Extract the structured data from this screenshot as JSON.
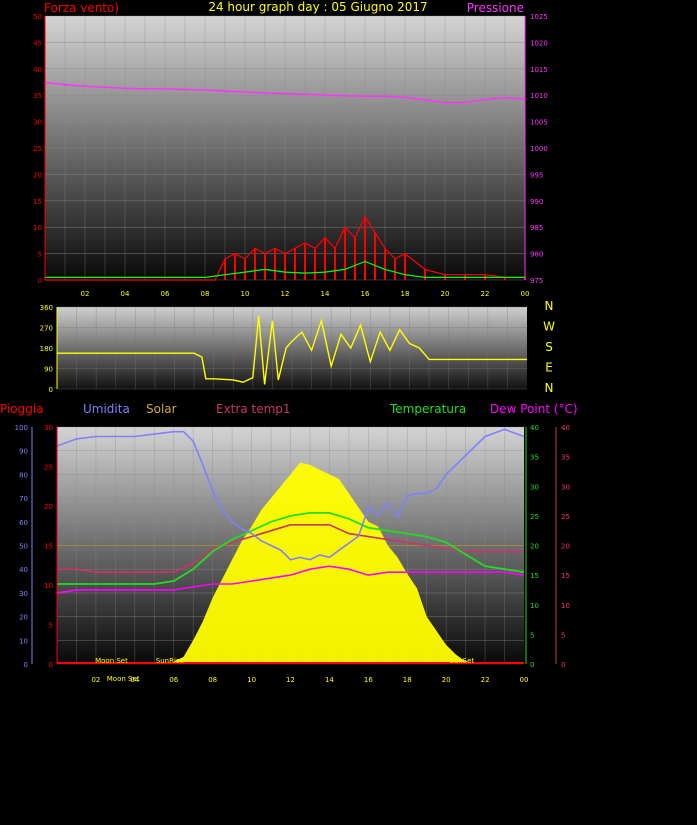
{
  "title": "24 hour graph day : 05 Giugno 2017",
  "colors": {
    "wind": "#ff0000",
    "gust": "#00ff00",
    "pressure": "#ff33ff",
    "direction": "#ffff00",
    "rain": "#ff0000",
    "humidity": "#8080ff",
    "solar": "#ffff00",
    "extra_temp": "#cc3366",
    "temperature": "#22dd22",
    "dew_point": "#ff00ff"
  },
  "chart_data": [
    {
      "type": "line",
      "left_label": "Forza vento)",
      "right_label": "Pressione",
      "left_ticks": [
        "0",
        "5",
        "10",
        "15",
        "20",
        "25",
        "30",
        "35",
        "40",
        "45",
        "50"
      ],
      "right_ticks": [
        "975",
        "980",
        "985",
        "990",
        "995",
        "1000",
        "1005",
        "1010",
        "1015",
        "1020",
        "1025"
      ],
      "x_ticks": [
        "02",
        "04",
        "06",
        "08",
        "10",
        "12",
        "14",
        "16",
        "18",
        "20",
        "22",
        "00"
      ],
      "ylim_left": [
        0,
        50
      ],
      "ylim_right": [
        975,
        1025
      ],
      "xlim": [
        0,
        24
      ],
      "grid": true,
      "series": [
        {
          "name": "Pressione",
          "axis": "right",
          "x": [
            0,
            1,
            2,
            3,
            4,
            5,
            6,
            7,
            8,
            9,
            10,
            11,
            12,
            13,
            14,
            15,
            16,
            17,
            18,
            19,
            20,
            21,
            22,
            23,
            24
          ],
          "values": [
            1012.4,
            1012.0,
            1011.7,
            1011.5,
            1011.3,
            1011.2,
            1011.2,
            1011.1,
            1011.0,
            1010.8,
            1010.6,
            1010.4,
            1010.3,
            1010.2,
            1010.0,
            1009.9,
            1009.8,
            1009.8,
            1009.6,
            1009.1,
            1008.6,
            1008.6,
            1009.2,
            1009.5,
            1009.3
          ]
        },
        {
          "name": "wind",
          "axis": "left",
          "x": [
            0,
            0.5,
            1,
            2,
            3,
            4,
            5,
            6,
            7,
            8,
            8.5,
            9,
            9.5,
            10,
            10.5,
            11,
            11.5,
            12,
            12.5,
            13,
            13.5,
            14,
            14.5,
            15,
            15.5,
            16,
            16.5,
            17,
            17.5,
            18,
            19,
            20,
            21,
            22,
            23,
            24
          ],
          "values": [
            0,
            0,
            0,
            0,
            0,
            0,
            0,
            0,
            0,
            0,
            0,
            4,
            5,
            4,
            6,
            5,
            6,
            5,
            6,
            7,
            6,
            8,
            6,
            10,
            8,
            12,
            9,
            6,
            4,
            5,
            2,
            1,
            1,
            1,
            0.5,
            0.5
          ]
        },
        {
          "name": "gust",
          "axis": "left",
          "x": [
            0,
            1,
            2,
            3,
            4,
            5,
            6,
            7,
            8,
            9,
            10,
            11,
            12,
            13,
            14,
            15,
            16,
            17,
            18,
            19,
            20,
            21,
            22,
            23,
            24
          ],
          "values": [
            0,
            0,
            0,
            0,
            0,
            0,
            0,
            0,
            0,
            0.5,
            1,
            1.5,
            1,
            0.8,
            1,
            1.5,
            3,
            1.5,
            0.5,
            0,
            0,
            0,
            0,
            0,
            0
          ]
        }
      ]
    },
    {
      "type": "line",
      "left_ticks": [
        "0",
        "90",
        "180",
        "270",
        "360"
      ],
      "right_labels": [
        "N",
        "W",
        "S",
        "E",
        "N"
      ],
      "ylim": [
        0,
        360
      ],
      "xlim": [
        0,
        24
      ],
      "grid": true,
      "series": [
        {
          "name": "direction",
          "x": [
            0,
            1,
            2,
            3,
            4,
            5,
            6,
            7,
            7.4,
            7.6,
            8,
            9,
            9.5,
            10,
            10.3,
            10.6,
            11,
            11.3,
            11.7,
            12,
            12.5,
            13,
            13.5,
            14,
            14.5,
            15,
            15.5,
            16,
            16.5,
            17,
            17.5,
            18,
            18.5,
            19,
            20,
            21,
            22,
            23,
            24
          ],
          "values": [
            157,
            157,
            157,
            157,
            157,
            157,
            157,
            157,
            140,
            45,
            45,
            40,
            30,
            50,
            320,
            20,
            300,
            40,
            180,
            210,
            250,
            170,
            300,
            100,
            240,
            180,
            280,
            120,
            250,
            170,
            260,
            200,
            180,
            130,
            130,
            130,
            130,
            130,
            130
          ]
        }
      ]
    },
    {
      "type": "line",
      "legend": [
        "Pioggia",
        "Umidita",
        "Solar",
        "Extra temp1",
        "Temperatura",
        "Dew Point (°C)"
      ],
      "humidity_ticks": [
        "0",
        "10",
        "20",
        "30",
        "40",
        "50",
        "60",
        "70",
        "80",
        "90",
        "100"
      ],
      "rain_ticks": [
        "0",
        "5",
        "10",
        "15",
        "20",
        "25",
        "30"
      ],
      "temp_ticks": [
        "0",
        "5",
        "10",
        "15",
        "20",
        "25",
        "30",
        "35",
        "40"
      ],
      "dew_ticks": [
        "0",
        "5",
        "10",
        "15",
        "20",
        "25",
        "30",
        "35",
        "40"
      ],
      "x_ticks": [
        "02",
        "04",
        "06",
        "08",
        "10",
        "12",
        "14",
        "16",
        "18",
        "20",
        "22",
        "00"
      ],
      "xlim": [
        0,
        24
      ],
      "grid": true,
      "annotations": [
        {
          "text": "Moon Set",
          "x": 2.8,
          "row": "top"
        },
        {
          "text": "Moon Set",
          "x": 3.4,
          "row": "bottom"
        },
        {
          "text": "SunRise",
          "x": 5.8,
          "row": "top"
        },
        {
          "text": "SunSet",
          "x": 20.8,
          "row": "top"
        }
      ],
      "series": [
        {
          "name": "Umidita",
          "axis": "humidity",
          "x": [
            0,
            1,
            2,
            3,
            4,
            5,
            6,
            6.5,
            7,
            7.5,
            8,
            8.5,
            9,
            9.5,
            10,
            10.5,
            11,
            11.5,
            12,
            12.5,
            13,
            13.5,
            14,
            14.5,
            15,
            15.5,
            16,
            16.5,
            17,
            17.5,
            18,
            18.5,
            19,
            19.5,
            20,
            21,
            22,
            23,
            24
          ],
          "values": [
            92,
            95,
            96,
            96,
            96,
            97,
            98,
            98,
            94,
            84,
            73,
            65,
            60,
            57,
            55,
            52,
            50,
            48,
            44,
            45,
            44,
            46,
            45,
            48,
            51,
            54,
            66,
            63,
            68,
            62,
            71,
            72,
            72,
            74,
            80,
            88,
            96,
            99,
            96
          ]
        },
        {
          "name": "Solar",
          "axis": "solar",
          "x": [
            0,
            5.5,
            6,
            6.5,
            7,
            7.5,
            8,
            8.5,
            9,
            9.5,
            10,
            10.5,
            11,
            11.5,
            12,
            12.5,
            13,
            13.5,
            14,
            14.5,
            15,
            15.5,
            16,
            16.5,
            17,
            17.5,
            18,
            18.5,
            19,
            19.5,
            20,
            20.5,
            21,
            24
          ],
          "values": [
            0,
            0,
            1,
            3,
            10,
            18,
            28,
            36,
            44,
            52,
            58,
            65,
            70,
            75,
            80,
            85,
            84,
            82,
            80,
            78,
            72,
            66,
            60,
            58,
            50,
            45,
            38,
            32,
            20,
            14,
            8,
            4,
            1,
            0
          ]
        },
        {
          "name": "Extra temp1",
          "axis": "temp",
          "x": [
            0,
            1,
            2,
            3,
            4,
            5,
            6,
            7,
            8,
            9,
            10,
            11,
            12,
            13,
            14,
            15,
            16,
            17,
            18,
            19,
            20,
            21,
            22,
            23,
            24
          ],
          "values": [
            16,
            16,
            15.5,
            15.5,
            15.5,
            15.5,
            15.5,
            17,
            19.5,
            20.5,
            21.5,
            22.5,
            23.5,
            23.5,
            23.5,
            22,
            21.5,
            21,
            20.5,
            20,
            19.5,
            19,
            19,
            19,
            19
          ]
        },
        {
          "name": "Temperatura",
          "axis": "temp",
          "x": [
            0,
            1,
            2,
            3,
            4,
            5,
            6,
            7,
            8,
            9,
            10,
            11,
            12,
            13,
            14,
            15,
            16,
            17,
            18,
            19,
            20,
            21,
            22,
            23,
            24
          ],
          "values": [
            13.5,
            13.5,
            13.5,
            13.5,
            13.5,
            13.5,
            14,
            16,
            19,
            21,
            22.5,
            24,
            25,
            25.5,
            25.5,
            24.5,
            23,
            22.5,
            22,
            21.5,
            20.5,
            18.5,
            16.5,
            16,
            15.5
          ]
        },
        {
          "name": "Dew Point (°C)",
          "axis": "temp",
          "x": [
            0,
            1,
            2,
            3,
            4,
            5,
            6,
            7,
            8,
            9,
            10,
            11,
            12,
            13,
            14,
            15,
            16,
            17,
            18,
            19,
            20,
            21,
            22,
            23,
            24
          ],
          "values": [
            12,
            12.5,
            12.5,
            12.5,
            12.5,
            12.5,
            12.5,
            13,
            13.5,
            13.5,
            14,
            14.5,
            15,
            16,
            16.5,
            16,
            15,
            15.5,
            15.5,
            15.5,
            15.5,
            15.5,
            15.5,
            15.5,
            15
          ]
        }
      ]
    }
  ]
}
